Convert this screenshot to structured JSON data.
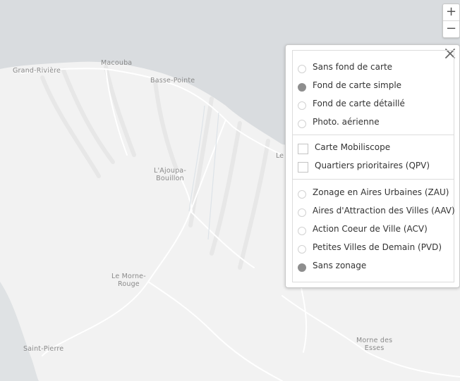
{
  "map": {
    "places": [
      {
        "id": "grand-riviere",
        "lines": [
          "Grand-Rivière"
        ]
      },
      {
        "id": "macouba",
        "lines": [
          "Macouba"
        ]
      },
      {
        "id": "basse-pointe",
        "lines": [
          "Basse-Pointe"
        ]
      },
      {
        "id": "ajoupa-bouillon",
        "lines": [
          "L'Ajoupa-",
          "Bouillon"
        ]
      },
      {
        "id": "morne-rouge",
        "lines": [
          "Le Morne-",
          "Rouge"
        ]
      },
      {
        "id": "saint-pierre",
        "lines": [
          "Saint-Pierre"
        ]
      },
      {
        "id": "morne-des-esses",
        "lines": [
          "Morne des",
          "Esses"
        ]
      }
    ],
    "edge_label": "Le",
    "colors": {
      "sea": "#d9dcdf",
      "land": "#f2f2f2",
      "road": "#ffffff",
      "label": "#8a8a8a"
    }
  },
  "zoom": {
    "in_label": "+",
    "out_label": "−"
  },
  "layers_panel": {
    "close_icon": "close-icon",
    "basemaps": [
      {
        "label": "Sans fond de carte",
        "selected": false
      },
      {
        "label": "Fond de carte simple",
        "selected": true
      },
      {
        "label": "Fond de carte détaillé",
        "selected": false
      },
      {
        "label": "Photo. aérienne",
        "selected": false
      }
    ],
    "overlays": [
      {
        "label": "Carte Mobiliscope",
        "checked": false
      },
      {
        "label": "Quartiers prioritaires (QPV)",
        "checked": false
      }
    ],
    "zonings": [
      {
        "label": "Zonage en Aires Urbaines (ZAU)",
        "selected": false
      },
      {
        "label": "Aires d'Attraction des Villes (AAV)",
        "selected": false
      },
      {
        "label": "Action Coeur de Ville (ACV)",
        "selected": false
      },
      {
        "label": "Petites Villes de Demain (PVD)",
        "selected": false
      },
      {
        "label": "Sans zonage",
        "selected": true
      }
    ]
  }
}
